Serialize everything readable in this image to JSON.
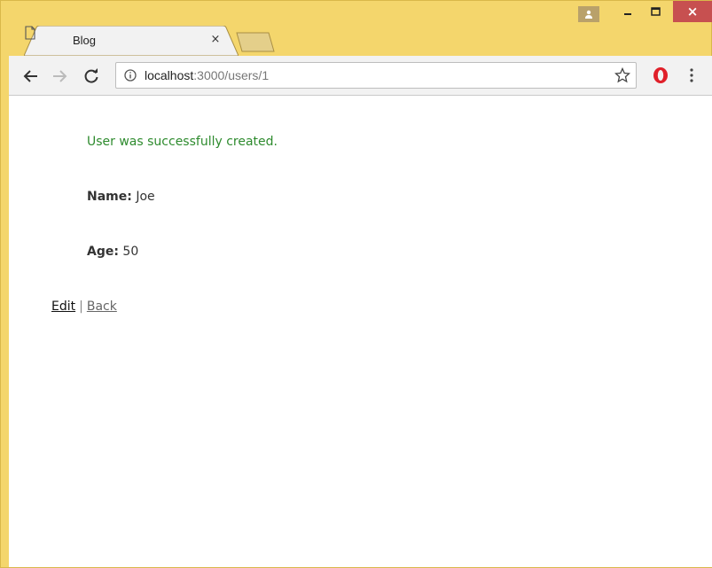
{
  "browser": {
    "tab": {
      "title": "Blog",
      "close_glyph": "×"
    },
    "address_bar": {
      "host": "localhost",
      "rest": ":3000/users/1"
    },
    "window_controls": {
      "close_glyph": "×"
    },
    "icons": {
      "back": "back-arrow-icon",
      "forward": "forward-arrow-icon",
      "reload": "reload-icon",
      "info": "info-icon",
      "bookmark": "star-icon",
      "extension": "opera-icon",
      "menu": "more-vert-icon"
    },
    "colors": {
      "frame": "#f4d66c",
      "close_button": "#c75050"
    }
  },
  "page": {
    "notice": "User was successfully created.",
    "fields": [
      {
        "label": "Name:",
        "value": "Joe"
      },
      {
        "label": "Age:",
        "value": "50"
      }
    ],
    "links": {
      "edit": "Edit",
      "separator": "|",
      "back": "Back"
    },
    "colors": {
      "notice": "#2e8b2e"
    }
  }
}
